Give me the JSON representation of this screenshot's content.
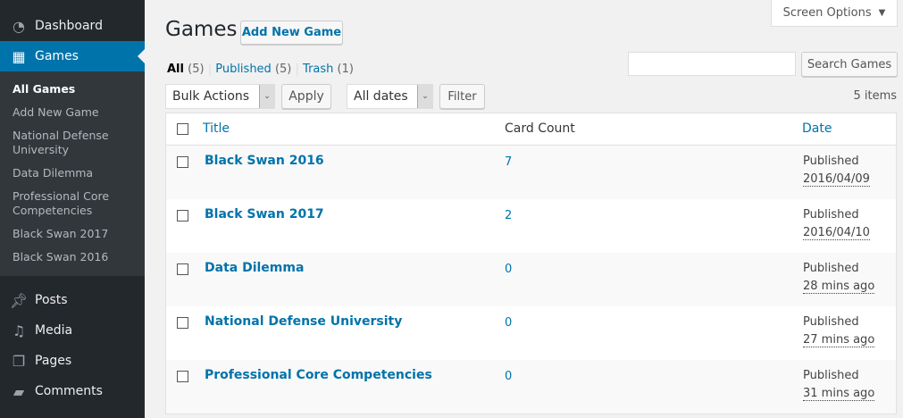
{
  "sidebar": {
    "menu": [
      {
        "label": "Dashboard",
        "icon": "dashboard-icon"
      },
      {
        "label": "Games",
        "icon": "games-icon"
      }
    ],
    "submenu": [
      "All Games",
      "Add New Game",
      "National Defense University",
      "Data Dilemma",
      "Professional Core Competencies",
      "Black Swan 2017",
      "Black Swan 2016"
    ],
    "lower": [
      {
        "label": "Posts",
        "icon": "pin-icon"
      },
      {
        "label": "Media",
        "icon": "media-icon"
      },
      {
        "label": "Pages",
        "icon": "pages-icon"
      },
      {
        "label": "Comments",
        "icon": "comment-icon"
      }
    ]
  },
  "header": {
    "title": "Games",
    "add_new": "Add New Game",
    "screen_options": "Screen Options"
  },
  "filters": {
    "all": "All",
    "all_count": "(5)",
    "published": "Published",
    "published_count": "(5)",
    "trash": "Trash",
    "trash_count": "(1)"
  },
  "search": {
    "value": "",
    "button": "Search Games"
  },
  "toolbar": {
    "bulk": "Bulk Actions",
    "apply": "Apply",
    "dates": "All dates",
    "filter": "Filter",
    "items": "5 items"
  },
  "table": {
    "columns": [
      "Title",
      "Card Count",
      "Date"
    ],
    "rows": [
      {
        "title": "Black Swan 2016",
        "count": "7",
        "status": "Published",
        "date": "2016/04/09"
      },
      {
        "title": "Black Swan 2017",
        "count": "2",
        "status": "Published",
        "date": "2016/04/10"
      },
      {
        "title": "Data Dilemma",
        "count": "0",
        "status": "Published",
        "date": "28 mins ago"
      },
      {
        "title": "National Defense University",
        "count": "0",
        "status": "Published",
        "date": "27 mins ago"
      },
      {
        "title": "Professional Core Competencies",
        "count": "0",
        "status": "Published",
        "date": "31 mins ago"
      }
    ]
  }
}
